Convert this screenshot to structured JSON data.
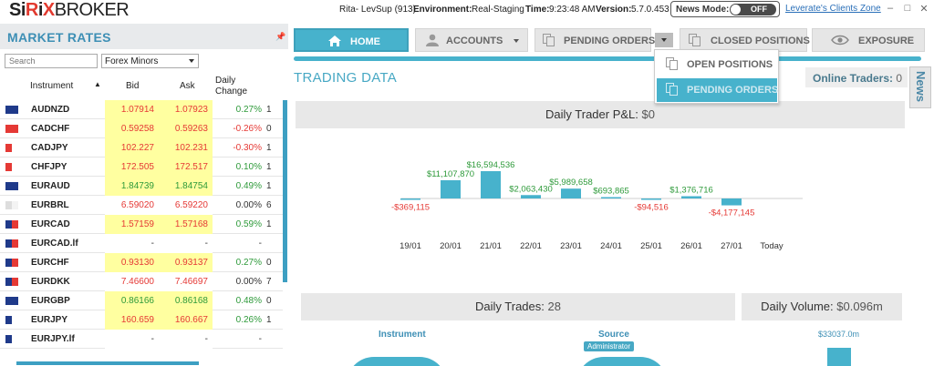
{
  "app": {
    "logo": "SiRiXBROKER",
    "user": "Rita- LevSup (913)",
    "environment_label": "Environment:",
    "environment": "Real-Staging",
    "time_label": "Time:",
    "time": "9:23:48 AM",
    "version_label": "Version:",
    "version": "5.7.0.453",
    "news_mode_label": "News Mode:",
    "news_mode_state": "OFF",
    "clients_zone_link": "Leverate's Clients Zone",
    "window_controls": [
      "‒",
      "□",
      "✕"
    ]
  },
  "market_rates": {
    "title": "MARKET RATES",
    "search_placeholder": "Search",
    "group_selected": "Forex Minors",
    "columns": {
      "instrument": "Instrument",
      "bid": "Bid",
      "ask": "Ask",
      "change_line1": "Daily",
      "change_line2": "Change"
    },
    "rows": [
      {
        "instrument": "AUDNZD",
        "bid": "1.07914",
        "ask": "1.07923",
        "change": "0.27%",
        "trail": "1",
        "bid_bg": "#ffffa0",
        "ask_bg": "#ffffa0",
        "color": "#e53935",
        "chg_color": "#2e9a3a",
        "flag": [
          "#1f3a8a",
          "#1f3a8a"
        ]
      },
      {
        "instrument": "CADCHF",
        "bid": "0.59258",
        "ask": "0.59263",
        "change": "-0.26%",
        "trail": "0",
        "bid_bg": "#ffffa0",
        "ask_bg": "#ffffa0",
        "color": "#e53935",
        "chg_color": "#e53935",
        "flag": [
          "#e53935",
          "#e53935"
        ]
      },
      {
        "instrument": "CADJPY",
        "bid": "102.227",
        "ask": "102.231",
        "change": "-0.30%",
        "trail": "1",
        "bid_bg": "#ffffa0",
        "ask_bg": "#ffffa0",
        "color": "#e53935",
        "chg_color": "#e53935",
        "flag": [
          "#e53935",
          "#ffffff"
        ]
      },
      {
        "instrument": "CHFJPY",
        "bid": "172.505",
        "ask": "172.517",
        "change": "0.10%",
        "trail": "1",
        "bid_bg": "#ffffa0",
        "ask_bg": "#ffffa0",
        "color": "#e53935",
        "chg_color": "#2e9a3a",
        "flag": [
          "#e53935",
          "#ffffff"
        ]
      },
      {
        "instrument": "EURAUD",
        "bid": "1.84739",
        "ask": "1.84754",
        "change": "0.49%",
        "trail": "1",
        "bid_bg": "#ffffa0",
        "ask_bg": "#ffffa0",
        "color": "#2e9a3a",
        "chg_color": "#2e9a3a",
        "flag": [
          "#1f3a8a",
          "#1f3a8a"
        ]
      },
      {
        "instrument": "EURBRL",
        "bid": "6.59020",
        "ask": "6.59220",
        "change": "0.00%",
        "trail": "6",
        "bid_bg": "#ffffff",
        "ask_bg": "#ffffff",
        "color": "#e53935",
        "chg_color": "#333333",
        "flag": [
          "#dddddd",
          "#f3f3f3"
        ]
      },
      {
        "instrument": "EURCAD",
        "bid": "1.57159",
        "ask": "1.57168",
        "change": "0.59%",
        "trail": "1",
        "bid_bg": "#ffffa0",
        "ask_bg": "#ffffa0",
        "color": "#e53935",
        "chg_color": "#2e9a3a",
        "flag": [
          "#1f3a8a",
          "#e53935"
        ]
      },
      {
        "instrument": "EURCAD.lf",
        "bid": "-",
        "ask": "-",
        "change": "-",
        "trail": "",
        "bid_bg": "#ffffff",
        "ask_bg": "#ffffff",
        "color": "#333333",
        "chg_color": "#333333",
        "flag": [
          "#1f3a8a",
          "#e53935"
        ]
      },
      {
        "instrument": "EURCHF",
        "bid": "0.93130",
        "ask": "0.93137",
        "change": "0.27%",
        "trail": "0",
        "bid_bg": "#ffffa0",
        "ask_bg": "#ffffa0",
        "color": "#e53935",
        "chg_color": "#2e9a3a",
        "flag": [
          "#1f3a8a",
          "#e53935"
        ]
      },
      {
        "instrument": "EURDKK",
        "bid": "7.46600",
        "ask": "7.46697",
        "change": "0.00%",
        "trail": "7",
        "bid_bg": "#ffffff",
        "ask_bg": "#ffffff",
        "color": "#e53935",
        "chg_color": "#333333",
        "flag": [
          "#1f3a8a",
          "#e53935"
        ]
      },
      {
        "instrument": "EURGBP",
        "bid": "0.86166",
        "ask": "0.86168",
        "change": "0.48%",
        "trail": "0",
        "bid_bg": "#ffffa0",
        "ask_bg": "#ffffa0",
        "color": "#2e9a3a",
        "chg_color": "#2e9a3a",
        "flag": [
          "#1f3a8a",
          "#1f3a8a"
        ]
      },
      {
        "instrument": "EURJPY",
        "bid": "160.659",
        "ask": "160.667",
        "change": "0.26%",
        "trail": "1",
        "bid_bg": "#ffffa0",
        "ask_bg": "#ffffa0",
        "color": "#e53935",
        "chg_color": "#2e9a3a",
        "flag": [
          "#1f3a8a",
          "#ffffff"
        ]
      },
      {
        "instrument": "EURJPY.lf",
        "bid": "-",
        "ask": "-",
        "change": "-",
        "trail": "",
        "bid_bg": "#ffffff",
        "ask_bg": "#ffffff",
        "color": "#333333",
        "chg_color": "#333333",
        "flag": [
          "#1f3a8a",
          "#ffffff"
        ]
      }
    ]
  },
  "nav": {
    "home": "HOME",
    "accounts": "ACCOUNTS",
    "pending_orders": "PENDING ORDERS",
    "closed_positions": "CLOSED POSITIONS",
    "exposure": "EXPOSURE",
    "menu": {
      "open_positions": "OPEN POSITIONS",
      "pending_orders": "PENDING ORDERS"
    }
  },
  "main": {
    "section_title": "TRADING DATA",
    "online_traders_label": "Online Traders:",
    "online_traders_value": "0",
    "news_tab": "News",
    "pnl_title": "Daily Trader P&L:",
    "pnl_value": "$0",
    "trades_title": "Daily Trades:",
    "trades_value": "28",
    "volume_title": "Daily Volume:",
    "volume_value": "$0.096m",
    "instrument_label": "Instrument",
    "source_label": "Source",
    "source_badge": "Administrator",
    "volume_bar_label": "$33037.0m"
  },
  "chart_data": {
    "type": "bar",
    "categories": [
      "19/01",
      "20/01",
      "21/01",
      "22/01",
      "23/01",
      "24/01",
      "25/01",
      "26/01",
      "27/01",
      "Today"
    ],
    "values": [
      -369115,
      11107870,
      16594536,
      2063430,
      5989658,
      693865,
      -94516,
      1376716,
      -4177145,
      0
    ],
    "labels": [
      "-$369,115",
      "$11,107,870",
      "$16,594,536",
      "$2,063,430",
      "$5,989,658",
      "$693,865",
      "-$94,516",
      "$1,376,716",
      "-$4,177,145",
      ""
    ],
    "title": "Daily Trader P&L",
    "bar_color": "#47b2cc",
    "positive_label_color": "#2e9a3a",
    "negative_label_color": "#e53935"
  }
}
